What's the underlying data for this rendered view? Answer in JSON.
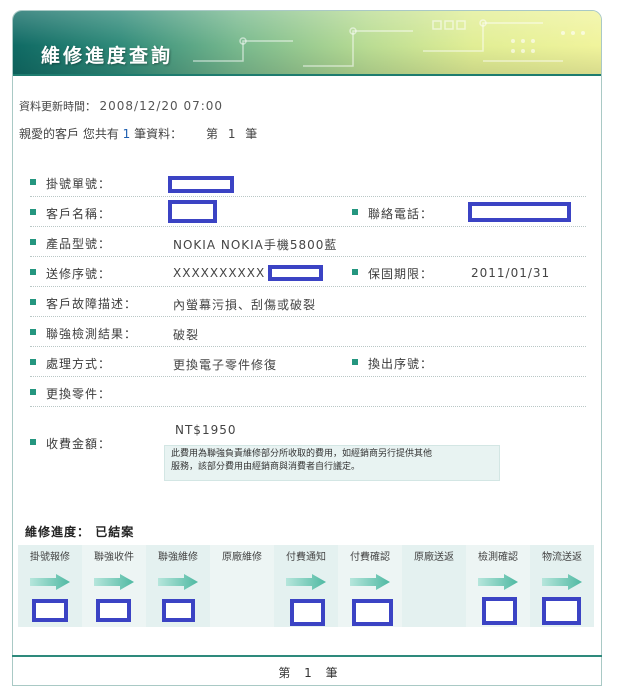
{
  "header": {
    "title": "維修進度查詢"
  },
  "update": {
    "label": "資料更新時間：",
    "value": "2008/12/20 07:00"
  },
  "summary": {
    "prefix": "親愛的客戶 您共有",
    "count": "1",
    "suffix": "筆資料：",
    "page_prefix": "第",
    "page_num": "1",
    "page_suffix": "筆"
  },
  "fields": {
    "ticket_no": {
      "label": "掛號單號：",
      "value": ""
    },
    "customer_name": {
      "label": "客戶名稱：",
      "value": ""
    },
    "phone": {
      "label": "聯絡電話：",
      "value": ""
    },
    "model": {
      "label": "產品型號：",
      "value": "NOKIA NOKIA手機5800藍"
    },
    "serial": {
      "label": "送修序號：",
      "value": "XXXXXXXXXX"
    },
    "warranty": {
      "label": "保固期限：",
      "value": "2011/01/31"
    },
    "fault": {
      "label": "客戶故障描述：",
      "value": "內螢幕污損、刮傷或破裂"
    },
    "test_result": {
      "label": "聯強檢測結果：",
      "value": "破裂"
    },
    "handling": {
      "label": "處理方式：",
      "value": "更換電子零件修復"
    },
    "swap_serial": {
      "label": "換出序號：",
      "value": ""
    },
    "parts": {
      "label": "更換零件：",
      "value": ""
    },
    "fee": {
      "label": "收費金額：",
      "value": "NT$1950"
    }
  },
  "fee_note": {
    "line1": "此費用為聯強負責維修部分所收取的費用，如經銷商另行提供其他",
    "line2": "服務，該部分費用由經銷商與消費者自行議定。"
  },
  "progress": {
    "label": "維修進度：",
    "state": "已結案",
    "steps": [
      "掛號報修",
      "聯強收件",
      "聯強維修",
      "原廠維修",
      "付費通知",
      "付費確認",
      "原廠送返",
      "檢測確認",
      "物流送返"
    ]
  },
  "footer": {
    "prefix": "第",
    "num": "1",
    "suffix": "筆"
  },
  "colors": {
    "accent": "#24967f",
    "redaction": "#3b43c4",
    "banner_dark": "#0f6a64",
    "banner_light": "#f1f49c"
  },
  "icons": {
    "bullet": "square-bullet-icon",
    "arrow": "right-arrow-icon"
  }
}
